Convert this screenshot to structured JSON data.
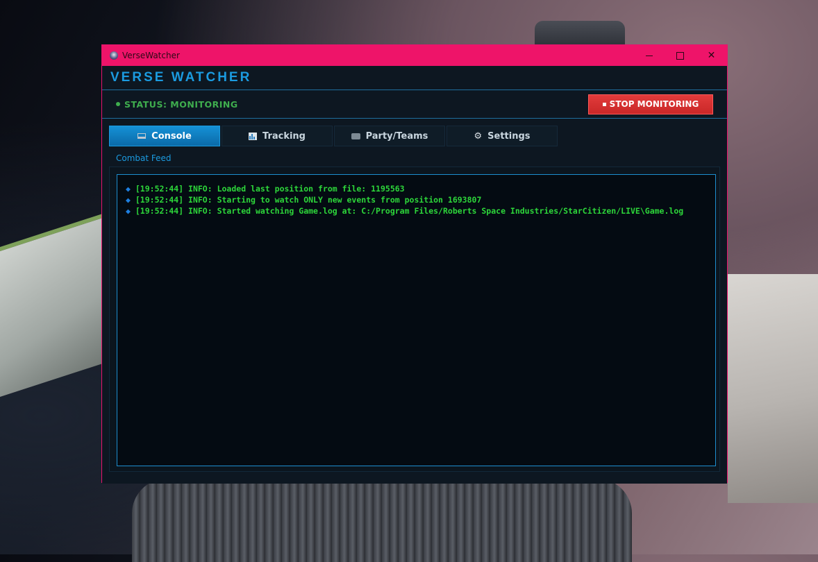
{
  "window": {
    "title": "VerseWatcher",
    "controls": {
      "minimize": "—",
      "maximize": "□",
      "close": "✕"
    }
  },
  "header": {
    "title": "VERSE WATCHER"
  },
  "status": {
    "label": "STATUS: MONITORING",
    "color": "#3fae4e",
    "stop_button": "STOP MONITORING"
  },
  "tabs": [
    {
      "label": "Console",
      "icon": "laptop-icon",
      "active": true
    },
    {
      "label": "Tracking",
      "icon": "chart-icon",
      "active": false
    },
    {
      "label": "Party/Teams",
      "icon": "party-icon",
      "active": false
    },
    {
      "label": "Settings",
      "icon": "gear-icon",
      "active": false
    }
  ],
  "console": {
    "section_label": "Combat Feed",
    "log": [
      {
        "bullet": "◆",
        "text": "[19:52:44] INFO: Loaded last position from file: 1195563"
      },
      {
        "bullet": "◆",
        "text": "[19:52:44] INFO: Starting to watch ONLY new events from position 1693807"
      },
      {
        "bullet": "◆",
        "text": "[19:52:44] INFO: Started watching Game.log at: C:/Program Files/Roberts Space Industries/StarCitizen/LIVE\\Game.log"
      }
    ]
  },
  "colors": {
    "accent": "#1b9be0",
    "titlebar": "#ee1469",
    "log_text": "#2dd63a",
    "stop_button": "#d63030"
  }
}
